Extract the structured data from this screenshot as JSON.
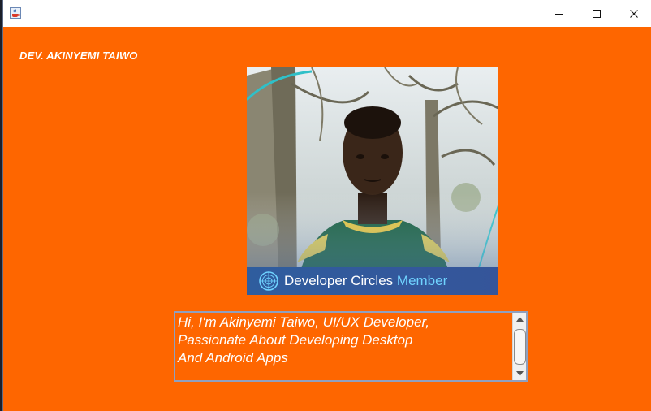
{
  "window": {
    "app_icon": "java-cup-icon",
    "controls": [
      "minimize-icon",
      "maximize-icon",
      "close-icon"
    ]
  },
  "header": {
    "author": "DEV. AKINYEMI TAIWO"
  },
  "photo": {
    "banner_text": "Developer Circles",
    "banner_accent": "Member",
    "banner_icon": "developer-circles-logo"
  },
  "bio": {
    "text": "Hi, I'm Akinyemi Taiwo, UI/UX Developer,\nPassionate About Developing Desktop\nAnd Android Apps"
  },
  "colors": {
    "background": "#fe6600",
    "text": "#ffffff",
    "banner": "#2f5d9e",
    "banner_accent": "#6fd3ff"
  }
}
